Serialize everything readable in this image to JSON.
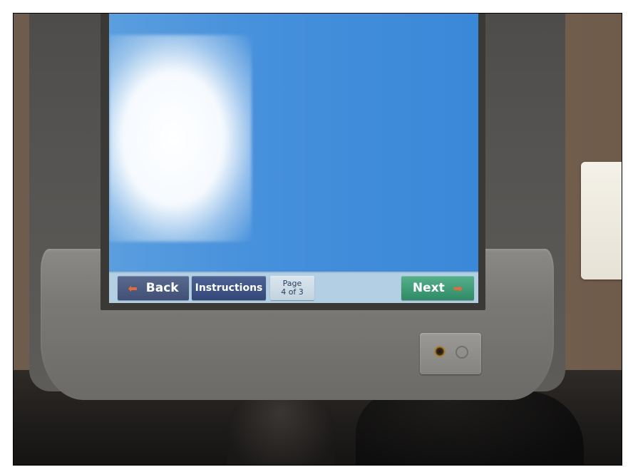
{
  "nav_bar": {
    "back_label": "Back",
    "instructions_label": "Instructions",
    "page_label": "Page",
    "page_count": "4 of 3",
    "next_label": "Next"
  },
  "icons": {
    "back_arrow": "arrow-left-icon",
    "next_arrow": "arrow-right-icon",
    "headphone_jack": "headphone-jack-icon"
  },
  "colors": {
    "screen_blue": "#4690dc",
    "back_button": "#3f4f76",
    "instructions_button": "#34477a",
    "next_button": "#2f8a66",
    "arrow_accent": "#e66a3c"
  }
}
